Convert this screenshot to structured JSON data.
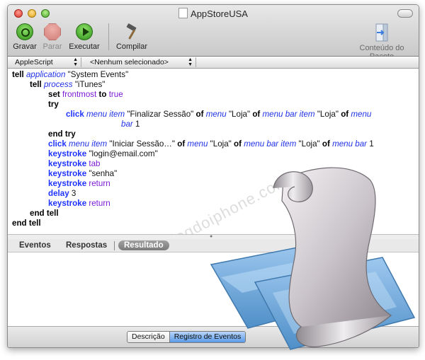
{
  "window": {
    "title": "AppStoreUSA"
  },
  "toolbar": {
    "record_label": "Gravar",
    "stop_label": "Parar",
    "run_label": "Executar",
    "compile_label": "Compilar",
    "bundle_label": "Conteúdo do Pacote"
  },
  "navbar": {
    "language": "AppleScript",
    "handler": "<Nenhum selecionado>"
  },
  "script": {
    "l1": {
      "a": "tell ",
      "b": "application",
      "c": " \"System Events\""
    },
    "l2": {
      "a": "tell ",
      "b": "process",
      "c": " \"iTunes\""
    },
    "l3": {
      "a": "set ",
      "b": "frontmost",
      "c": " to ",
      "d": "true"
    },
    "l4": {
      "a": "try"
    },
    "l5": {
      "a": "click ",
      "b": "menu item",
      "c": " \"Finalizar Sessão\" ",
      "d": "of ",
      "e": "menu",
      "f": " \"Loja\" ",
      "g": "of ",
      "h": "menu bar item",
      "i": " \"Loja\" ",
      "j": "of ",
      "k": "menu"
    },
    "l6": {
      "a": "bar",
      "b": " 1"
    },
    "l7": {
      "a": "end try"
    },
    "l8": {
      "a": "click ",
      "b": "menu item",
      "c": " \"Iniciar Sessão…\" ",
      "d": "of ",
      "e": "menu",
      "f": " \"Loja\" ",
      "g": "of ",
      "h": "menu bar item",
      "i": " \"Loja\" ",
      "j": "of ",
      "k": "menu bar",
      "l": " 1"
    },
    "l9": {
      "a": "keystroke",
      "b": " \"login@email.com\""
    },
    "l10": {
      "a": "keystroke",
      "b": " tab"
    },
    "l11": {
      "a": "keystroke",
      "b": " \"senha\""
    },
    "l12": {
      "a": "keystroke",
      "b": " return"
    },
    "l13": {
      "a": "delay",
      "b": " 3"
    },
    "l14": {
      "a": "keystroke",
      "b": " return"
    },
    "l15": {
      "a": "end tell"
    },
    "l16": {
      "a": "end tell"
    }
  },
  "watermark": "blogdoiphone.com",
  "tabs": {
    "events": "Eventos",
    "replies": "Respostas",
    "result": "Resultado"
  },
  "bottom": {
    "description": "Descrição",
    "event_log": "Registro de Eventos"
  },
  "colors": {
    "keyword": "#000000",
    "command": "#1f33ff",
    "class": "#2133e8",
    "variable": "#7c1bd6"
  }
}
